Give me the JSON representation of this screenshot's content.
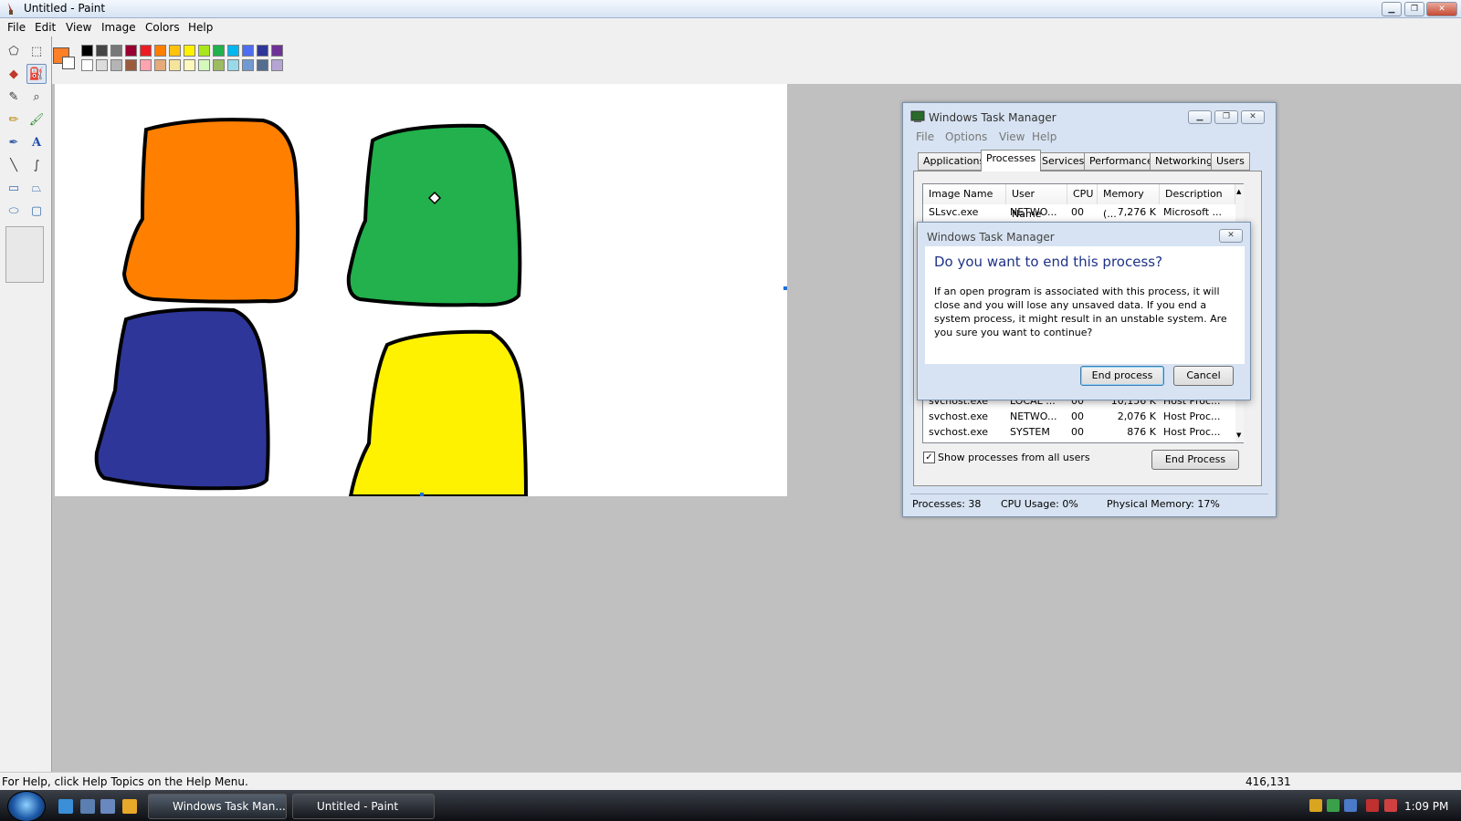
{
  "window": {
    "title": "Untitled - Paint"
  },
  "menu": [
    "File",
    "Edit",
    "View",
    "Image",
    "Colors",
    "Help"
  ],
  "palette": {
    "fg_color": "#ff7f27",
    "bg_color": "#ffffff",
    "row1": [
      "#000000",
      "#464646",
      "#787878",
      "#990030",
      "#ed1c24",
      "#ff7e00",
      "#ffc20e",
      "#fff200",
      "#a8e61d",
      "#22b14c",
      "#00b7ef",
      "#4d6df3",
      "#2f3699",
      "#6f3198"
    ],
    "row2": [
      "#ffffff",
      "#dcdcdc",
      "#b4b4b4",
      "#9c5a3c",
      "#ffa3b1",
      "#e5aa7a",
      "#f5e49c",
      "#fff9bd",
      "#d3f9bc",
      "#9dbb61",
      "#99d9ea",
      "#709ad1",
      "#546d8e",
      "#b5a5d5"
    ]
  },
  "tools": [
    "free-select-icon",
    "rect-select-icon",
    "eraser-icon",
    "fill-icon",
    "color-picker-icon",
    "magnifier-icon",
    "pencil-icon",
    "brush-icon",
    "airbrush-icon",
    "text-icon",
    "line-icon",
    "curve-icon",
    "rectangle-icon",
    "polygon-icon",
    "ellipse-icon",
    "rounded-rect-icon"
  ],
  "blobs": [
    {
      "color": "#ff7f00"
    },
    {
      "color": "#22b14c"
    },
    {
      "color": "#2f3699"
    },
    {
      "color": "#fff200"
    }
  ],
  "status": {
    "help": "For Help, click Help Topics on the Help Menu.",
    "coords": "416,131"
  },
  "taskmanager": {
    "title": "Windows Task Manager",
    "menu": [
      "File",
      "Options",
      "View",
      "Help"
    ],
    "tabs": [
      "Applications",
      "Processes",
      "Services",
      "Performance",
      "Networking",
      "Users"
    ],
    "columns": [
      "Image Name",
      "User Name",
      "CPU",
      "Memory (...",
      "Description"
    ],
    "rows": [
      {
        "name": "SLsvc.exe",
        "user": "NETWO...",
        "cpu": "00",
        "mem": "7,276 K",
        "desc": "Microsoft ..."
      },
      {
        "name": "svchost.exe",
        "user": "LOCAL ...",
        "cpu": "00",
        "mem": "10,156 K",
        "desc": "Host Proc..."
      },
      {
        "name": "svchost.exe",
        "user": "NETWO...",
        "cpu": "00",
        "mem": "2,076 K",
        "desc": "Host Proc..."
      },
      {
        "name": "svchost.exe",
        "user": "SYSTEM",
        "cpu": "00",
        "mem": "876 K",
        "desc": "Host Proc..."
      }
    ],
    "show_all_label": "Show processes from all users",
    "show_all_checked": true,
    "end_process_label": "End Process",
    "status": {
      "processes": "Processes: 38",
      "cpu": "CPU Usage: 0%",
      "memory": "Physical Memory: 17%"
    }
  },
  "dialog": {
    "title": "Windows Task Manager",
    "question": "Do you want to end this process?",
    "text": "If an open program is associated with this process, it will close and you will lose any unsaved data. If you end a system process, it might result in an unstable system. Are you sure you want to continue?",
    "confirm_label": "End process",
    "cancel_label": "Cancel"
  },
  "taskbar": {
    "buttons": [
      "Windows Task Man...",
      "Untitled - Paint"
    ],
    "clock": "1:09 PM"
  }
}
